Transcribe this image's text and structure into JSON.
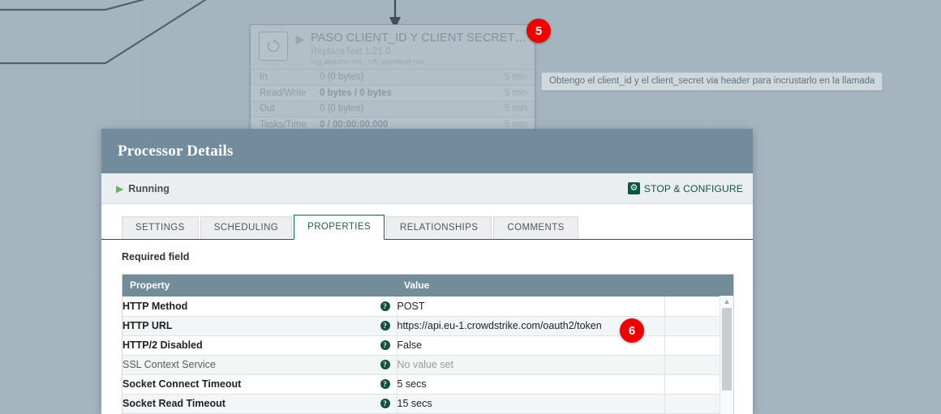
{
  "canvas": {
    "background_color": "#a5b5c0",
    "arrow_icon": "down-arrow-icon"
  },
  "processor": {
    "name": "PASO CLIENT_ID Y CLIENT SECRET C...",
    "type": "ReplaceText 1.21.0",
    "bundle": "org.apache.nifi - nifi-standard-nar",
    "type_icon": "replace-text-processor-icon",
    "run_icon": "play-icon",
    "stats": [
      {
        "label": "In",
        "value": "0 (0 bytes)",
        "bold": false,
        "time": "5 min"
      },
      {
        "label": "Read/Write",
        "value": "0 bytes / 0 bytes",
        "bold": true,
        "time": "5 min"
      },
      {
        "label": "Out",
        "value": "0 (0 bytes)",
        "bold": false,
        "time": "5 min"
      },
      {
        "label": "Tasks/Time",
        "value": "0 / 00:00:00.000",
        "bold": true,
        "time": "5 min"
      }
    ]
  },
  "tooltip": {
    "text": "Obtengo el client_id y el client_secret via header para incrustarlo en la llamada"
  },
  "badges": [
    {
      "label": "5"
    },
    {
      "label": "6"
    }
  ],
  "dialog": {
    "title": "Processor Details",
    "header_color": "#728c9e",
    "toolbar": {
      "status_label": "Running",
      "status_icon": "play-icon",
      "status_color": "#68b06a",
      "stop_configure_label": "STOP & CONFIGURE",
      "stop_configure_icon": "gear-icon"
    },
    "tabs": [
      {
        "label": "SETTINGS",
        "active": false
      },
      {
        "label": "SCHEDULING",
        "active": false
      },
      {
        "label": "PROPERTIES",
        "active": true
      },
      {
        "label": "RELATIONSHIPS",
        "active": false
      },
      {
        "label": "COMMENTS",
        "active": false
      }
    ],
    "required_field_note": "Required field",
    "table": {
      "headers": {
        "property": "Property",
        "value": "Value",
        "pad": ""
      },
      "help_icon": "help-icon",
      "scrollbar": {
        "up_arrow_icon": "chevron-up-icon"
      },
      "rows": [
        {
          "property": "HTTP Method",
          "value": "POST",
          "required": true,
          "unset": false
        },
        {
          "property": "HTTP URL",
          "value": "https://api.eu-1.crowdstrike.com/oauth2/token",
          "required": true,
          "unset": false
        },
        {
          "property": "HTTP/2 Disabled",
          "value": "False",
          "required": true,
          "unset": false
        },
        {
          "property": "SSL Context Service",
          "value": "No value set",
          "required": false,
          "unset": true
        },
        {
          "property": "Socket Connect Timeout",
          "value": "5 secs",
          "required": true,
          "unset": false
        },
        {
          "property": "Socket Read Timeout",
          "value": "15 secs",
          "required": true,
          "unset": false
        }
      ]
    }
  }
}
